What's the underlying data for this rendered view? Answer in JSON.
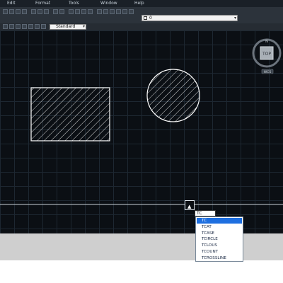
{
  "menubar": {
    "items": [
      "Edit",
      "Format",
      "Tools",
      "Window",
      "Help"
    ]
  },
  "toolbar": {
    "layer_name": "0",
    "text_style": "Standard"
  },
  "command": {
    "input_value": "TC",
    "suggestions": [
      "TC",
      "TCAT",
      "TCASE",
      "TCIRCLE",
      "TCLOUS",
      "TCOUNT",
      "TCROSSLINE"
    ],
    "selected_index": 0
  },
  "viewcube": {
    "face_label": "TOP",
    "wcs_label": "WCS"
  },
  "colors": {
    "canvas_bg": "#0b0f14",
    "grid": "#1d2731",
    "geometry": "#ffffff",
    "highlight": "#1e6fe0"
  }
}
